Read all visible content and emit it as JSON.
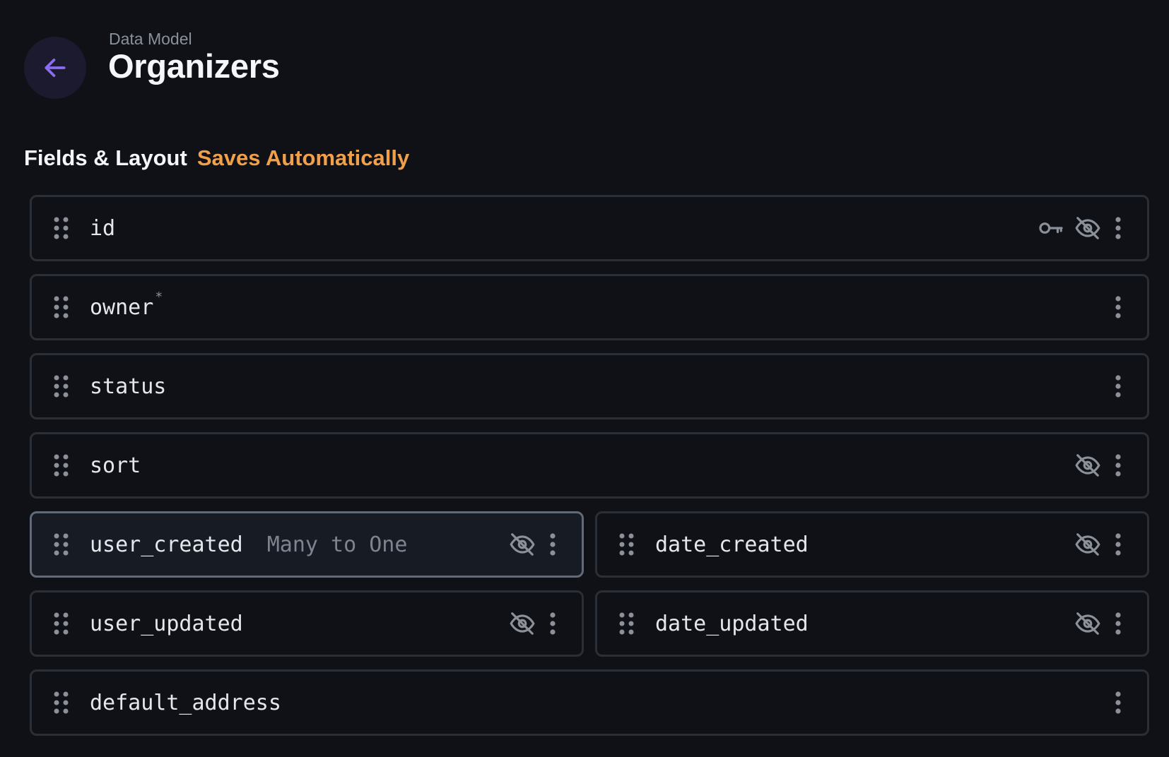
{
  "header": {
    "breadcrumb": "Data Model",
    "title": "Organizers"
  },
  "section": {
    "title": "Fields & Layout",
    "note": "Saves Automatically"
  },
  "colors": {
    "background": "#0f1117",
    "accent": "#8b6cf0",
    "note": "#f0a04b",
    "border": "#2a2e36",
    "active_border": "#636a77"
  },
  "fields": {
    "id": {
      "name": "id",
      "icons": [
        "key-icon",
        "eye-off-icon",
        "more-vertical-icon"
      ]
    },
    "owner": {
      "name": "owner",
      "required_mark": "*",
      "icons": [
        "more-vertical-icon"
      ]
    },
    "status": {
      "name": "status",
      "icons": [
        "more-vertical-icon"
      ]
    },
    "sort": {
      "name": "sort",
      "icons": [
        "eye-off-icon",
        "more-vertical-icon"
      ]
    },
    "user_created": {
      "name": "user_created",
      "type": "Many to One",
      "icons": [
        "eye-off-icon",
        "more-vertical-icon"
      ]
    },
    "date_created": {
      "name": "date_created",
      "icons": [
        "eye-off-icon",
        "more-vertical-icon"
      ]
    },
    "user_updated": {
      "name": "user_updated",
      "icons": [
        "eye-off-icon",
        "more-vertical-icon"
      ]
    },
    "date_updated": {
      "name": "date_updated",
      "icons": [
        "eye-off-icon",
        "more-vertical-icon"
      ]
    },
    "default_address": {
      "name": "default_address",
      "icons": [
        "more-vertical-icon"
      ]
    }
  }
}
